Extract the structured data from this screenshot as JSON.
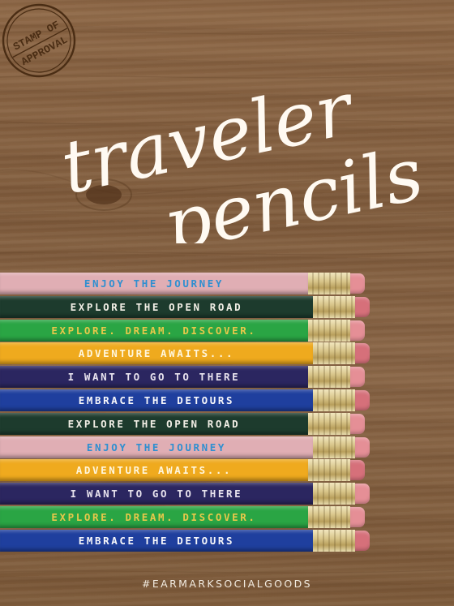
{
  "stamp": {
    "line1": "STAMP OF",
    "line2": "APPROVAL",
    "color": "#4a2d14"
  },
  "headline": {
    "line1": "traveler",
    "line2": "pencils"
  },
  "pencils": [
    {
      "text": "ENJOY THE JOURNEY",
      "body_color": "#e0aeb4",
      "text_color": "#2f8fd0",
      "eraser_color": "#e58f96"
    },
    {
      "text": "EXPLORE THE OPEN ROAD",
      "body_color": "#1d3b2d",
      "text_color": "#f2efe6",
      "eraser_color": "#d6707a"
    },
    {
      "text": "EXPLORE. DREAM. DISCOVER.",
      "body_color": "#2aa544",
      "text_color": "#e8c84a",
      "eraser_color": "#e58f96"
    },
    {
      "text": "ADVENTURE AWAITS...",
      "body_color": "#efaa1e",
      "text_color": "#fff6dc",
      "eraser_color": "#d6707a"
    },
    {
      "text": "I WANT TO GO TO THERE",
      "body_color": "#2b2660",
      "text_color": "#e8e3ee",
      "eraser_color": "#e58f96"
    },
    {
      "text": "EMBRACE THE DETOURS",
      "body_color": "#1f3f9e",
      "text_color": "#f7f7fb",
      "eraser_color": "#d6707a"
    },
    {
      "text": "EXPLORE THE OPEN ROAD",
      "body_color": "#1d3b2d",
      "text_color": "#f2efe6",
      "eraser_color": "#e58f96"
    },
    {
      "text": "ENJOY THE JOURNEY",
      "body_color": "#e0aeb4",
      "text_color": "#2f8fd0",
      "eraser_color": "#e58f96"
    },
    {
      "text": "ADVENTURE AWAITS...",
      "body_color": "#efaa1e",
      "text_color": "#fff6dc",
      "eraser_color": "#d6707a"
    },
    {
      "text": "I WANT TO GO TO THERE",
      "body_color": "#2b2660",
      "text_color": "#e8e3ee",
      "eraser_color": "#e58f96"
    },
    {
      "text": "EXPLORE. DREAM. DISCOVER.",
      "body_color": "#2aa544",
      "text_color": "#e8c84a",
      "eraser_color": "#e58f96"
    },
    {
      "text": "EMBRACE THE DETOURS",
      "body_color": "#1f3f9e",
      "text_color": "#f7f7fb",
      "eraser_color": "#d6707a"
    }
  ],
  "hashtag": "#EARMARKSOCIALGOODS"
}
